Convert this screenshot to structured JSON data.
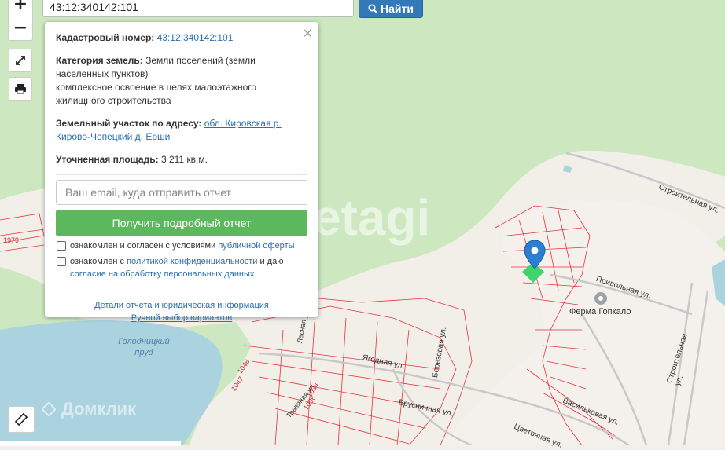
{
  "map": {
    "zoom_in_label": "+",
    "zoom_out_label": "−",
    "labels": {
      "pond": "Голодницкий пруд",
      "farm": "Ферма Гопкало",
      "street_stroitelnaya_1": "Строительная ул.",
      "street_stroitelnaya_2": "Строительная ул.",
      "street_privolnaya": "Привольная ул.",
      "street_yagodnaya": "Ягодная ул.",
      "street_berezovaya": "Березовая ул.",
      "street_brusnichnaya": "Брусничная ул.",
      "street_vasilkovaya": "Васильковая ул.",
      "street_tsvetochnaya": "Цветочная ул.",
      "street_lesnaya": "Лесная ул.",
      "street_travyanaya": "Травяная ул.",
      "plot_1979": "1979",
      "plot_1046": "1046",
      "plot_1047": "1047",
      "plot_1034": "1034",
      "plot_1036": "1036"
    },
    "watermark_etagi": "etagi",
    "watermark_domclick": "Домклик"
  },
  "search": {
    "value": "43:12:340142:101",
    "button_label": "Найти"
  },
  "popup": {
    "close_label": "×",
    "cadastral_label": "Кадастровый номер:",
    "cadastral_value": "43:12:340142:101",
    "category_label": "Категория земель:",
    "category_value": "Земли поселений (земли населенных пунктов)",
    "category_use": "комплексное освоение в целях малоэтажного жилищного строительства",
    "address_label": "Земельный участок по адресу:",
    "address_value": "обл. Кировская р. Кирово-Чепецкий д. Ерши",
    "area_label": "Уточненная площадь:",
    "area_value": "3 211 кв.м.",
    "email_placeholder": "Ваш email, куда отправить отчет",
    "report_button": "Получить подробный отчет",
    "consent1_text": "ознакомлен и согласен с условиями",
    "consent1_link": "публичной оферты",
    "consent2_text_a": "ознакомлен с",
    "consent2_link_a": "политикой конфиденциальности",
    "consent2_text_b": "и даю",
    "consent2_link_b": "согласие на обработку персональных данных",
    "details_link": "Детали отчета и юридическая информация",
    "manual_link": "Ручной выбор вариантов"
  },
  "colors": {
    "forest": "#cde8c0",
    "water": "#aad3df",
    "cadastre": "#e8323c",
    "marker": "#2a7fd0",
    "parcel": "#3fd46a"
  }
}
